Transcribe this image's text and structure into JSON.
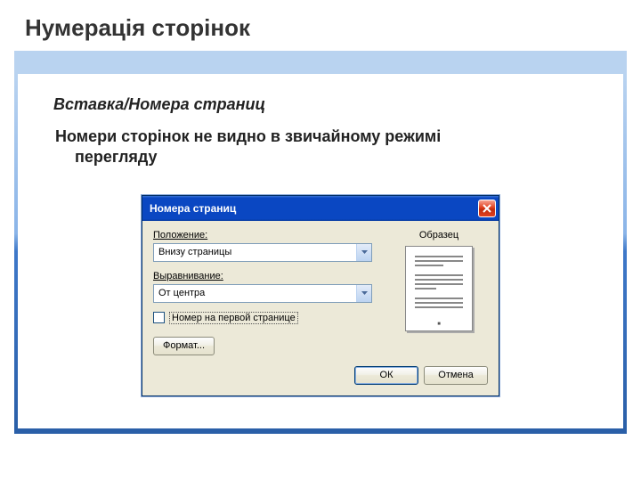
{
  "slide": {
    "title": "Нумерація сторінок",
    "menu_path": "Вставка/Номера страниц",
    "note_line1": "Номери сторінок не видно в звичайному режимі",
    "note_line2": "перегляду"
  },
  "dialog": {
    "title": "Номера страниц",
    "position_label": "Положение:",
    "position_value": "Внизу страницы",
    "align_label": "Выравнивание:",
    "align_value": "От центра",
    "first_page_label": "Номер на первой странице",
    "preview_label": "Образец",
    "format_btn": "Формат...",
    "ok_btn": "ОК",
    "cancel_btn": "Отмена"
  }
}
